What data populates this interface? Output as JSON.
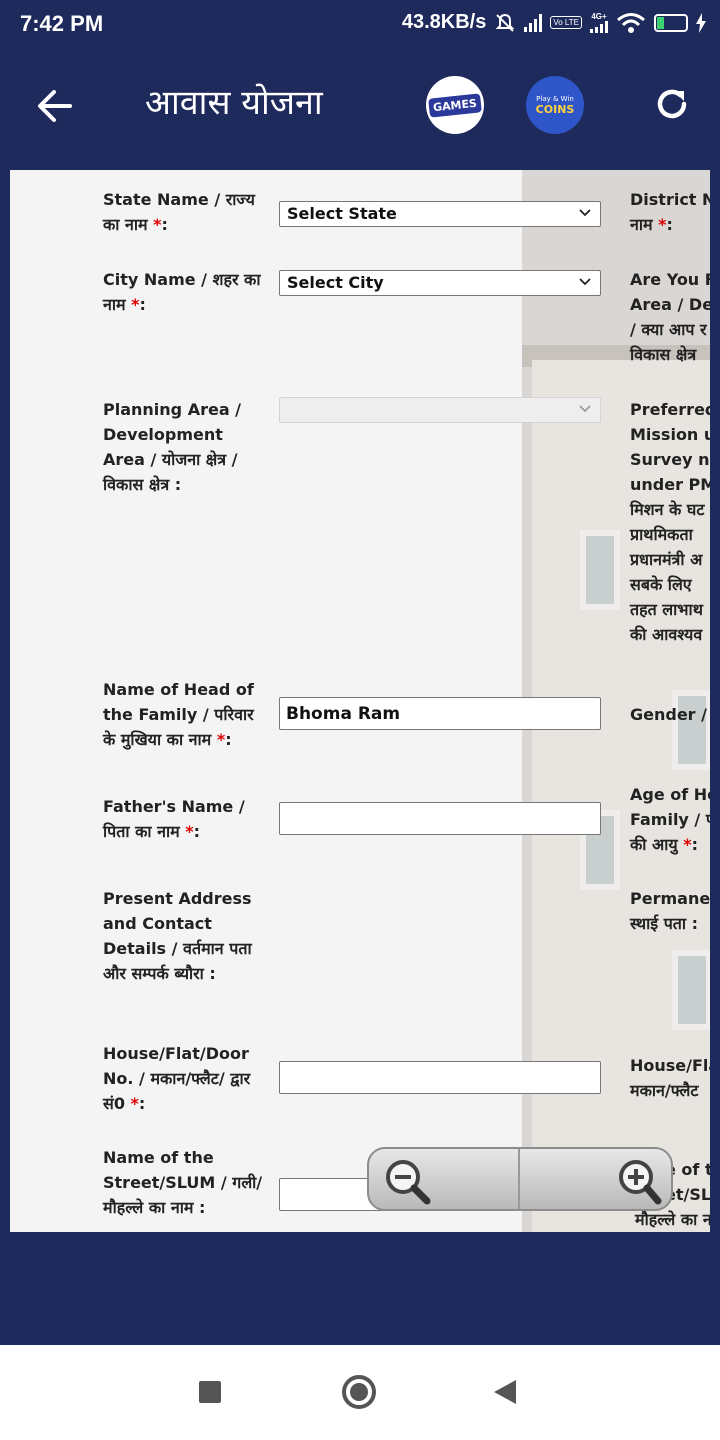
{
  "status": {
    "time": "7:42 PM",
    "speed": "43.8KB/s",
    "battery": "24",
    "battery_level": 0.24,
    "network_tag": "4G+",
    "volte_tag": "Vo LTE"
  },
  "app_bar": {
    "title": "आवास योजना",
    "logo_games": "GAMES",
    "logo_coins_top": "Play & Win",
    "logo_coins": "COINS"
  },
  "form": {
    "state_label": "State Name / राज्य का नाम ",
    "state_value": "Select State",
    "district_label_line1": "District Na",
    "district_label_line2": "नाम ",
    "city_label": "City Name / शहर का नाम ",
    "city_value": "Select City",
    "are_you_line1": "Are You Fr",
    "are_you_line2": "Area / Dev",
    "are_you_line3": "/ क्या आप र",
    "are_you_line4": "विकास क्षेत्र",
    "planning_label": "Planning Area / Development Area / योजना क्षेत्र / विकास क्षेत्र :",
    "planning_value": "",
    "preferred_line1": "Preferred",
    "preferred_line2": "Mission u",
    "preferred_line3": "Survey ne",
    "preferred_line4": "under PM/",
    "preferred_line5": "मिशन के घट",
    "preferred_line6": "प्राथमिकता",
    "preferred_line7": "प्रधानमंत्री अ",
    "preferred_line8": "सबके लिए ",
    "preferred_line9": "तहत लाभाथ",
    "preferred_line10": "की आवश्यव",
    "head_label": "Name of Head of the Family / परिवार के मुखिया का नाम ",
    "head_value": "Bhoma Ram",
    "gender_label": "Gender / f",
    "father_label": "Father's Name / पिता का नाम ",
    "father_value": "",
    "age_line1": "Age of He",
    "age_line2": "Family / प",
    "age_line3": "की आयु ",
    "present_label": "Present Address and Contact Details / वर्तमान पता और सम्पर्क ब्यौरा :",
    "permanent_line1": "Permanen",
    "permanent_line2": "स्थाई पता :",
    "house_label": "House/Flat/Door No. / मकान/फ्लैट/ द्वार सं0 ",
    "house_value": "",
    "house2_line1": "House/Fla",
    "house2_line2": "मकान/फ्लैट",
    "street_label": "Name of the Street/SLUM / गली/मौहल्ले का नाम :",
    "street_value": "",
    "street2_line1": "e of th",
    "street2_line2": "et/SLU",
    "street2_line3": "मौहल्ले का न",
    "required_mark": "*",
    "colon": ":"
  },
  "colors": {
    "app_bar": "#1f2a5c",
    "required": "#dd0000",
    "content_bg": "#f4f4f4"
  },
  "icons": {
    "back": "arrow-left-icon",
    "refresh": "refresh-icon",
    "zoom_out": "zoom-out-icon",
    "zoom_in": "zoom-in-icon"
  }
}
